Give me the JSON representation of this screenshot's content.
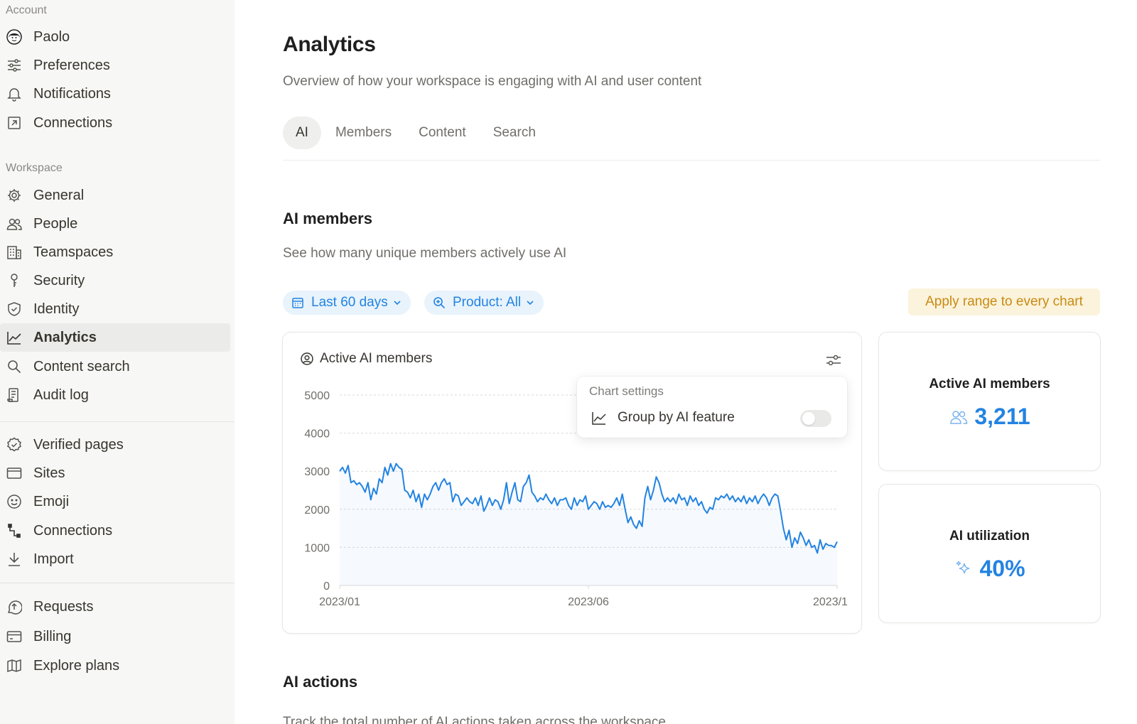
{
  "sidebar": {
    "account_label": "Account",
    "account_items": [
      {
        "label": "Paolo",
        "icon": "avatar-icon"
      },
      {
        "label": "Preferences",
        "icon": "sliders-icon"
      },
      {
        "label": "Notifications",
        "icon": "bell-icon"
      },
      {
        "label": "Connections",
        "icon": "external-link-box-icon"
      }
    ],
    "workspace_label": "Workspace",
    "workspace_items": [
      {
        "label": "General",
        "icon": "gear-icon"
      },
      {
        "label": "People",
        "icon": "people-icon"
      },
      {
        "label": "Teamspaces",
        "icon": "building-icon"
      },
      {
        "label": "Security",
        "icon": "key-icon"
      },
      {
        "label": "Identity",
        "icon": "shield-check-icon"
      },
      {
        "label": "Analytics",
        "icon": "line-chart-icon",
        "active": true
      },
      {
        "label": "Content search",
        "icon": "search-icon"
      },
      {
        "label": "Audit log",
        "icon": "scroll-icon"
      }
    ],
    "extra_items": [
      {
        "label": "Verified pages",
        "icon": "verified-badge-icon"
      },
      {
        "label": "Sites",
        "icon": "browser-window-icon"
      },
      {
        "label": "Emoji",
        "icon": "smiley-icon"
      },
      {
        "label": "Connections",
        "icon": "connection-icon"
      },
      {
        "label": "Import",
        "icon": "download-arrow-icon"
      }
    ],
    "bottom_items": [
      {
        "label": "Requests",
        "icon": "upload-circle-icon"
      },
      {
        "label": "Billing",
        "icon": "credit-card-icon"
      },
      {
        "label": "Explore plans",
        "icon": "map-icon"
      }
    ]
  },
  "main": {
    "title": "Analytics",
    "subtitle": "Overview of how your workspace is engaging with AI and user content",
    "tabs": [
      {
        "label": "AI",
        "active": true
      },
      {
        "label": "Members"
      },
      {
        "label": "Content"
      },
      {
        "label": "Search"
      }
    ],
    "section_title": "AI members",
    "section_subtitle": "See how many unique members actively use AI",
    "filters": {
      "range": "Last 60 days",
      "product": "Product: All",
      "apply": "Apply range to every chart"
    },
    "chart_card": {
      "title": "Active AI members",
      "settings": {
        "title": "Chart settings",
        "group_by_label": "Group by AI feature",
        "group_by_enabled": false
      }
    },
    "stats": [
      {
        "title": "Active AI members",
        "value": "3,211",
        "icon": "people-icon"
      },
      {
        "title": "AI utilization",
        "value": "40%",
        "icon": "sparkle-icon"
      }
    ],
    "next_section_title": "AI actions",
    "next_section_subtitle": "Track the total number of AI actions taken across the workspace"
  },
  "colors": {
    "accent": "#2383e2",
    "apply_bg": "#fbf3db",
    "apply_text": "#c98a14",
    "sidebar_bg": "#f7f7f5"
  },
  "chart_data": {
    "type": "area",
    "title": "",
    "xlabel": "",
    "ylabel": "",
    "ylim": [
      0,
      5000
    ],
    "yticks": [
      "0",
      "1000",
      "2000",
      "3000",
      "5000",
      "4000"
    ],
    "y_tick_values": [
      0,
      1000,
      2000,
      3000,
      4000,
      5000
    ],
    "x_ticks": [
      "2023/01",
      "2023/06",
      "2023/1"
    ],
    "grid": true,
    "series": [
      {
        "values": [
          3000,
          3100,
          2950,
          3150,
          2700,
          2750,
          2650,
          2700,
          2600,
          2450,
          2700,
          2250,
          2550,
          2400,
          2800,
          2700,
          3100,
          2900,
          3200,
          3000,
          3200,
          3100,
          3050,
          2500,
          2450,
          2300,
          2500,
          2200,
          2400,
          2050,
          2400,
          2250,
          2400,
          2600,
          2700,
          2500,
          2700,
          2800,
          2650,
          2700,
          2200,
          2400,
          2350,
          2100,
          2200,
          2300,
          2200,
          2150,
          2300,
          2100,
          2350,
          1950,
          2100,
          2300,
          2100,
          2250,
          2200,
          2000,
          2250,
          2700,
          2150,
          2450,
          2700,
          2250,
          2200,
          2600,
          2700,
          2900,
          2450,
          2350,
          2200,
          2300,
          2250,
          2400,
          2250,
          2150,
          2300,
          2100,
          2250,
          2250,
          2300,
          2100,
          2000,
          2300,
          2100,
          2250,
          2200,
          2350,
          2000,
          2100,
          2200,
          2150,
          2000,
          2200,
          2050,
          2100,
          2050,
          2150,
          2300,
          2100,
          2400,
          2000,
          1650,
          1800,
          1600,
          1500,
          1700,
          1550,
          2300,
          2600,
          2250,
          2500,
          2850,
          2700,
          2400,
          2200,
          2300,
          2200,
          2300,
          2150,
          2400,
          2250,
          2300,
          2100,
          2350,
          2200,
          2300,
          2100,
          2200,
          2000,
          1900,
          2050,
          2000,
          2300,
          2250,
          2350,
          2300,
          2400,
          2250,
          2350,
          2200,
          2300,
          2200,
          2350,
          2150,
          2300,
          2200,
          2350,
          2150,
          2300,
          2400,
          2300,
          2100,
          2300,
          2400,
          2350,
          1950,
          1500,
          1200,
          1450,
          1000,
          1250,
          1100,
          1400,
          1250,
          1050,
          1200,
          1000,
          1050,
          850,
          1200,
          950,
          1100,
          1050,
          1050,
          1000,
          1150
        ]
      }
    ]
  }
}
